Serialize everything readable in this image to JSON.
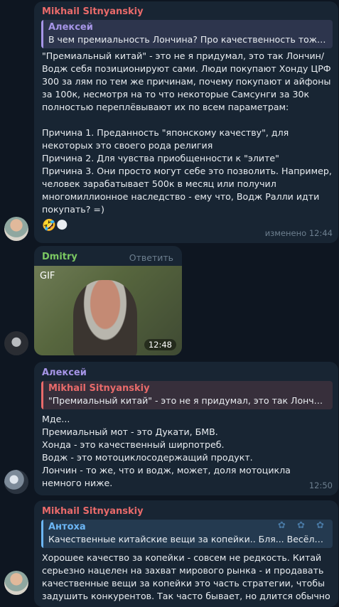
{
  "messages": [
    {
      "sender": "Mikhail Sitnyanskiy",
      "reply": {
        "name": "Алексей",
        "text": "В чем премиальность Лончина?  Про качественность тоже п…"
      },
      "text": "\"Премиальный китай\" - это не я придумал, это так Лончин/Водж себя позиционируют сами. Люди покупают Хонду ЦРФ 300 за лям по тем же причинам, почему покупают и айфоны за 100к, несмотря на то что некоторые Самсунги за 30к полностью переплёвывают их по всем параметрам:\n\nПричина 1. Преданность \"японскому качеству\", для некоторых это своего рода религия\nПричина 2. Для чувства приобщенности к \"элите\"\nПричина 3. Они просто могут себе это позволить. Например, человек зарабатывает 500к в месяц или получил многомиллионное наследство - ему что, Водж Ралли идти покупать? =)",
      "emoji": "🤣🌑",
      "time": "изменено 12:44"
    },
    {
      "sender": "Dmitry",
      "action": "Ответить",
      "gif_label": "GIF",
      "time": "12:48"
    },
    {
      "sender": "Алексей",
      "reply": {
        "name": "Mikhail Sitnyanskiy",
        "text": "\"Премиальный китай\" - это не я придумал, это так Лончин/В…"
      },
      "text": "Мде...\nПремиальный мот - это Дукати, БМВ.\nХонда - это качественный ширпотреб.\nВодж - это мотоциклосодержащий продукт.\nЛончин - то же, что и водж, может, доля мотоцикла немного ниже.",
      "time": "12:50"
    },
    {
      "sender": "Mikhail Sitnyanskiy",
      "reply": {
        "name": "Антоха",
        "text": "Качественные китайские вещи за копейки.. Бля... Весёлый ты…"
      },
      "text": "Хорошее качество за копейки - совсем не редкость. Китай серьезно нацелен на захват мирового рынка - и продавать качественные вещи за копейки это часть стратегии, чтобы задушить конкурентов. Так часто бывает, но длится обычно"
    }
  ],
  "colors": {
    "background": "#0e1621",
    "bubble": "#182533",
    "mikhail": "#e86a6a",
    "aleksey": "#a695e7",
    "dmitry": "#7bc862",
    "antokha": "#6cb6f5",
    "time": "#6d7f8f"
  }
}
